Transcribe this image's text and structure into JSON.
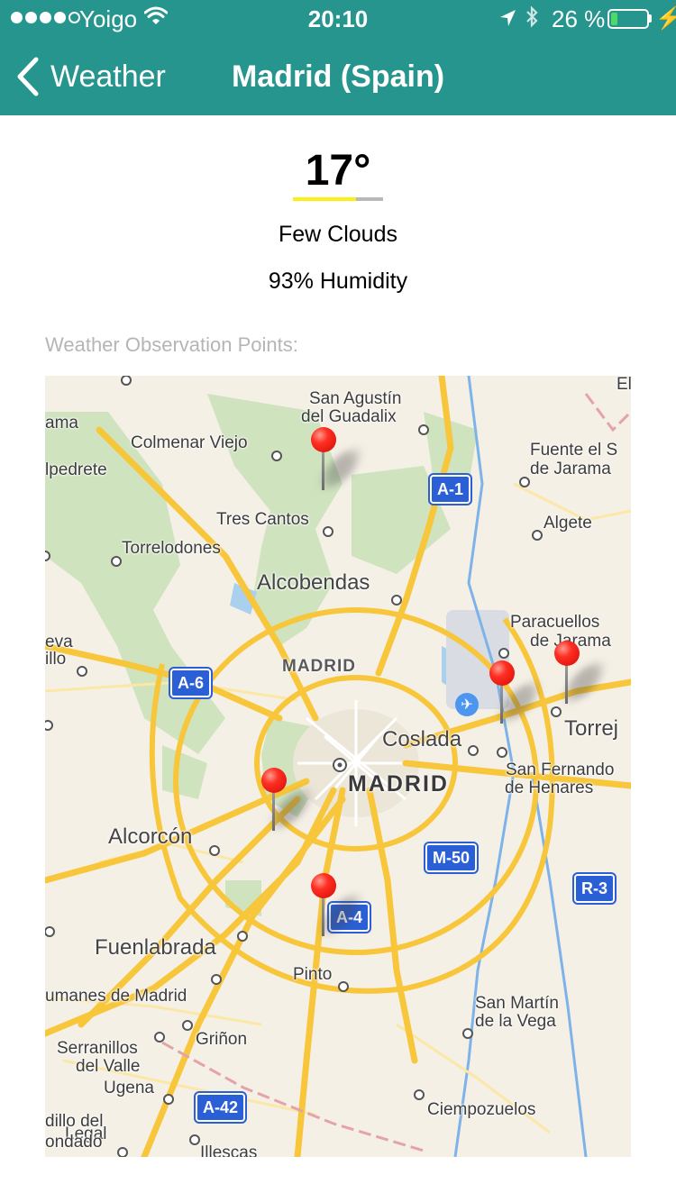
{
  "status_bar": {
    "carrier": "Yoigo",
    "time": "20:10",
    "battery_percent": "26 %",
    "battery_level": 0.26,
    "signal_bars_filled": 4,
    "signal_bars_total": 5
  },
  "nav": {
    "back_label": "Weather",
    "title": "Madrid (Spain)"
  },
  "weather": {
    "temperature": "17°",
    "temperature_bar_fraction": 0.7,
    "condition": "Few Clouds",
    "humidity": "93% Humidity"
  },
  "observation_points_label": "Weather Observation Points:",
  "map": {
    "places": [
      "San Agustín",
      "del Guadalix",
      "Colmenar Viejo",
      "lpedrete",
      "ama",
      "Fuente el S",
      "de Jarama",
      "El",
      "Tres Cantos",
      "Algete",
      "Torrelodones",
      "Alcobendas",
      "Paracuellos",
      "de Jarama",
      "eva",
      "illo",
      "MADRID",
      "Torrej",
      "Coslada",
      "San Fernando",
      "de Henares",
      "MADRID",
      "Alcorcón",
      "Fuenlabrada",
      "Pinto",
      "umanes de Madrid",
      "San Martín",
      "de la Vega",
      "Serranillos",
      "del Valle",
      "Griñon",
      "Ugena",
      "Ciempozuelos",
      "dillo del",
      "Legal",
      "ondado",
      "Illescas"
    ],
    "road_shields": [
      "A-1",
      "A-6",
      "M-50",
      "A-4",
      "R-3",
      "A-42"
    ]
  },
  "colors": {
    "nav_background": "#26958e",
    "temperature_bar_fill": "#ffee11",
    "pin_red": "#ff2e22",
    "road_shield_blue": "#2a5fd6",
    "highway_yellow": "#f8c63a"
  }
}
